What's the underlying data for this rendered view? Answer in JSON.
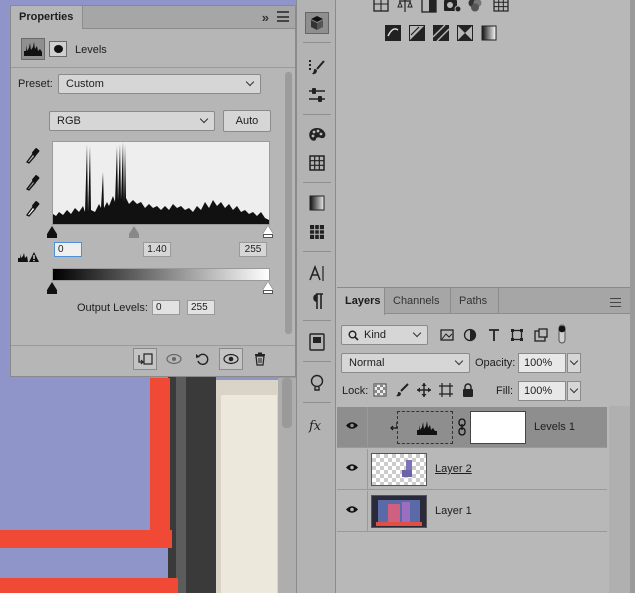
{
  "properties": {
    "tab_title": "Properties",
    "adjustment_title": "Levels",
    "preset_label": "Preset:",
    "preset_value": "Custom",
    "channel_value": "RGB",
    "auto_label": "Auto",
    "input_black": "0",
    "input_gamma": "1.40",
    "input_white": "255",
    "output_label": "Output Levels:",
    "output_black": "0",
    "output_white": "255"
  },
  "layers_panel": {
    "tabs": [
      "Layers",
      "Channels",
      "Paths"
    ],
    "filter_kind": "Kind",
    "blend_mode": "Normal",
    "opacity_label": "Opacity:",
    "opacity_value": "100%",
    "lock_label": "Lock:",
    "fill_label": "Fill:",
    "fill_value": "100%",
    "layers": [
      {
        "name": "Levels 1",
        "selected": true
      },
      {
        "name": "Layer 2",
        "selected": false
      },
      {
        "name": "Layer 1",
        "selected": false
      }
    ]
  },
  "colors": {
    "canvas_blue": "#8f95c8",
    "accent_red": "#f04a37",
    "focus_blue": "#4f8fd8"
  },
  "icons": {
    "toolstrip": [
      "info-icon",
      "brush-settings-icon",
      "sliders-icon",
      "color-palette-icon",
      "swatches-grid-icon",
      "gradient-icon",
      "pattern-icon",
      "character-icon",
      "paragraph-icon",
      "libraries-icon",
      "lightbulb-icon",
      "fx-styles-icon"
    ],
    "adjustments": [
      "brightness-icon",
      "levels-icon",
      "curves-icon",
      "exposure-icon",
      "vibrance-icon",
      "hue-sat-icon",
      "color-balance-icon",
      "black-white-icon",
      "photo-filter-icon",
      "channel-mixer-icon",
      "color-lookup-icon",
      "invert-icon",
      "posterize-icon",
      "threshold-icon",
      "gradient-map-icon",
      "selective-color-icon"
    ]
  }
}
